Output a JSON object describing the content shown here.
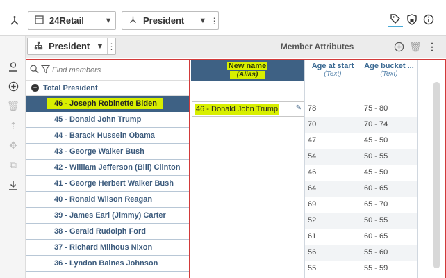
{
  "toolbar": {
    "dimension_dropdown": {
      "label": "24Retail"
    },
    "hierarchy_dropdown": {
      "label": "President"
    }
  },
  "member_header": {
    "hierarchy_label": "President"
  },
  "attributes_header": {
    "title": "Member Attributes"
  },
  "search": {
    "placeholder": "Find members"
  },
  "tree": {
    "root": "Total President",
    "members": [
      "46 - Joseph Robinette Biden",
      "45 - Donald John Trump",
      "44 - Barack Hussein Obama",
      "43 - George Walker Bush",
      "42 - William Jefferson (Bill) Clinton",
      "41 - George Herbert Walker Bush",
      "40 - Ronald Wilson Reagan",
      "39 - James Earl (Jimmy) Carter",
      "38 - Gerald Rudolph Ford",
      "37 - Richard Milhous Nixon",
      "36 - Lyndon Baines Johnson"
    ],
    "selected_index": 0
  },
  "columns": {
    "new_name": {
      "title": "New name",
      "sub": "(Alias)"
    },
    "age_start": {
      "title": "Age at start",
      "sub": "(Text)"
    },
    "age_bucket": {
      "title": "Age bucket ...",
      "sub": "(Text)"
    }
  },
  "edit_cell": {
    "value": "46 - Donald John Trump"
  },
  "rows": [
    {
      "age": "78",
      "bucket": "75 - 80"
    },
    {
      "age": "70",
      "bucket": "70 - 74"
    },
    {
      "age": "47",
      "bucket": "45 - 50"
    },
    {
      "age": "54",
      "bucket": "50 - 55"
    },
    {
      "age": "46",
      "bucket": "45 - 50"
    },
    {
      "age": "64",
      "bucket": "60 - 65"
    },
    {
      "age": "69",
      "bucket": "65 - 70"
    },
    {
      "age": "52",
      "bucket": "50 - 55"
    },
    {
      "age": "61",
      "bucket": "60 - 65"
    },
    {
      "age": "56",
      "bucket": "55 - 60"
    },
    {
      "age": "55",
      "bucket": "55 - 59"
    }
  ],
  "colors": {
    "selection": "#3e6184",
    "highlight": "#d8ef00",
    "frame": "#d23a3a"
  },
  "icons": [
    "hierarchy-icon",
    "table-icon",
    "tag-icon",
    "lock-icon",
    "info-icon",
    "user-icon",
    "add-icon",
    "trash-icon",
    "kebab-icon",
    "search-icon",
    "filter-icon",
    "download-icon",
    "pencil-icon"
  ]
}
